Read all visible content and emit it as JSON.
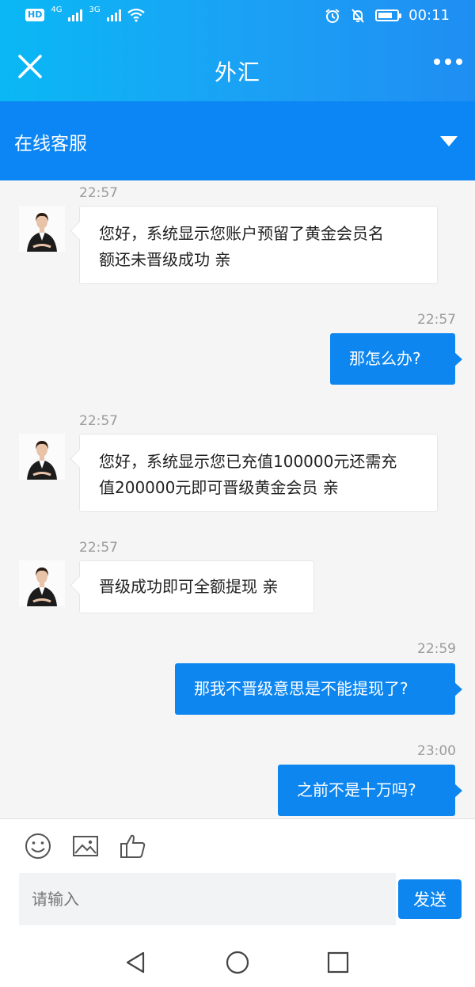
{
  "status_bar": {
    "hd": "HD",
    "net1": "4G",
    "net2": "3G",
    "time": "00:11",
    "battery_level": 0.75
  },
  "header": {
    "title": "外汇"
  },
  "service_bar": {
    "label": "在线客服"
  },
  "messages": [
    {
      "dir": "in",
      "time": "22:57",
      "text_lines": [
        "您好，系统显示您账户预留了黄金会员名",
        "额还未晋级成功 亲"
      ]
    },
    {
      "dir": "out",
      "time": "22:57",
      "text": "那怎么办?"
    },
    {
      "dir": "in",
      "time": "22:57",
      "text_lines": [
        "您好，系统显示您已充值100000元还需充",
        "值200000元即可晋级黄金会员 亲"
      ]
    },
    {
      "dir": "in",
      "time": "22:57",
      "text": "晋级成功即可全额提现 亲"
    },
    {
      "dir": "out",
      "time": "22:59",
      "text": "那我不晋级意思是不能提现了?"
    },
    {
      "dir": "out",
      "time": "23:00",
      "text": "之前不是十万吗?"
    }
  ],
  "input_bar": {
    "placeholder": "请输入",
    "send_label": "发送",
    "tools": [
      "emoji-icon",
      "image-icon",
      "thumbs-up-icon"
    ]
  },
  "nav_bar": {
    "buttons": [
      "back-triangle-icon",
      "home-circle-icon",
      "recents-square-icon"
    ]
  },
  "colors": {
    "header_start": "#0ab8f5",
    "header_end": "#1f8ef3",
    "service_bar": "#0b86f4",
    "outgoing_bubble": "#0d86f0"
  }
}
